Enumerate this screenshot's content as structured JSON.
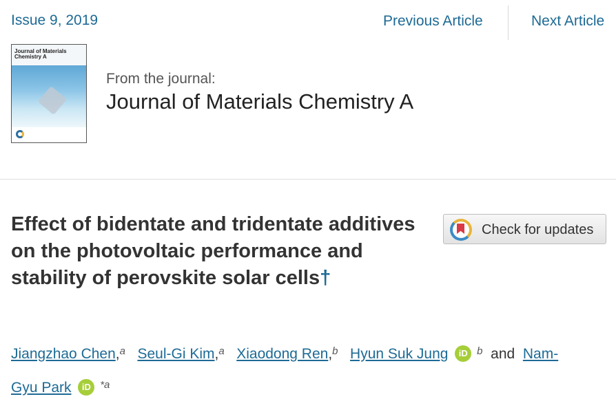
{
  "nav": {
    "issue": "Issue 9, 2019",
    "previous": "Previous Article",
    "next": "Next Article"
  },
  "journal": {
    "cover_title": "Journal of Materials Chemistry A",
    "from_label": "From the journal:",
    "name": "Journal of Materials Chemistry A"
  },
  "article": {
    "title": "Effect of bidentate and tridentate additives on the photovoltaic performance and stability of perovskite solar cells",
    "dagger": "†",
    "check_updates": "Check for updates"
  },
  "authors": [
    {
      "name": "Jiangzhao Chen",
      "aff": "a"
    },
    {
      "name": "Seul-Gi Kim",
      "aff": "a"
    },
    {
      "name": "Xiaodong Ren",
      "aff": "b"
    },
    {
      "name": "Hyun Suk Jung",
      "aff": "b"
    },
    {
      "name_part1": "Nam-",
      "name_part2": "Gyu Park",
      "aff": "*a"
    }
  ],
  "and_text": "and",
  "orcid_label": "iD",
  "colors": {
    "link": "#1d6a95",
    "orcid": "#a6ce39",
    "text": "#333333"
  }
}
